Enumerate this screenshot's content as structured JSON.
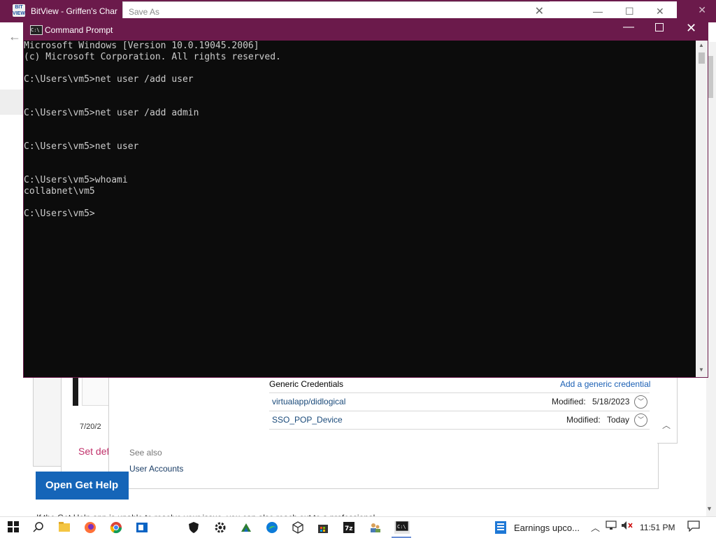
{
  "background_window": {
    "title": "BitView - Griffen's Char",
    "logo_text": "BIT VIEW"
  },
  "save_as": {
    "title": "Save As"
  },
  "credential_manager": {
    "generic_header": "Generic Credentials",
    "add_link": "Add a generic credential",
    "rows": [
      {
        "name": "virtualapp/didlogical",
        "modified_label": "Modified:",
        "modified_value": "5/18/2023"
      },
      {
        "name": "SSO_POP_Device",
        "modified_label": "Modified:",
        "modified_value": "Today"
      }
    ],
    "see_also": "See also",
    "user_accounts": "User Accounts",
    "set_default_partial": "Set def",
    "open_button_partial": "Open Get Help",
    "date_partial": "7/20/2",
    "bottom_text_partial": "If the Get Help app is unable to resolve your issue, you can also reach out to a professional"
  },
  "cmd": {
    "title": "Command Prompt",
    "icon_text": "C:\\",
    "lines": [
      "Microsoft Windows [Version 10.0.19045.2006]",
      "(c) Microsoft Corporation. All rights reserved.",
      "",
      "C:\\Users\\vm5>net user /add user",
      "",
      "",
      "C:\\Users\\vm5>net user /add admin",
      "",
      "",
      "C:\\Users\\vm5>net user",
      "",
      "",
      "C:\\Users\\vm5>whoami",
      "collabnet\\vm5",
      "",
      "C:\\Users\\vm5>"
    ]
  },
  "taskbar": {
    "news_text": "Earnings upco...",
    "clock": "11:51 PM",
    "icons": [
      "windows-start-icon",
      "search-icon",
      "file-explorer-icon",
      "firefox-icon",
      "chrome-icon",
      "outlook-icon",
      "security-shield-icon",
      "settings-gear-icon",
      "game-icon",
      "edge-icon",
      "cube-icon",
      "store-icon",
      "7zip-icon",
      "users-icon",
      "command-prompt-icon"
    ],
    "accent_color": "#6b1a4b"
  }
}
